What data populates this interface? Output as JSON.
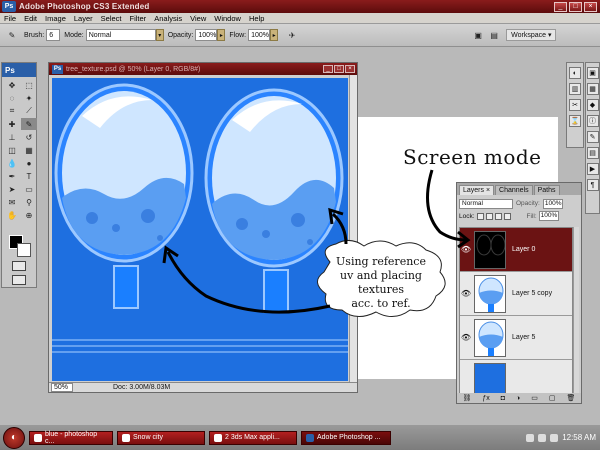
{
  "window": {
    "title": "Adobe Photoshop CS3 Extended",
    "app_badge": "Ps"
  },
  "menu": [
    "File",
    "Edit",
    "Image",
    "Layer",
    "Select",
    "Filter",
    "Analysis",
    "View",
    "Window",
    "Help"
  ],
  "options_bar": {
    "brush_label": "Brush:",
    "brush_size": "6",
    "mode_label": "Mode:",
    "mode_value": "Normal",
    "opacity_label": "Opacity:",
    "opacity_value": "100%",
    "flow_label": "Flow:",
    "flow_value": "100%",
    "workspace_label": "Workspace ▾"
  },
  "toolbox": {
    "header": "Ps"
  },
  "document": {
    "title": "tree_texture.psd @ 50% (Layer 0, RGB/8#)",
    "zoom": "50%",
    "doc_size": "Doc: 3.00M/8.03M"
  },
  "layers_panel": {
    "tabs": [
      "Layers ×",
      "Channels",
      "Paths"
    ],
    "blend_mode": "Normal",
    "opacity_label": "Opacity:",
    "opacity_value": "100%",
    "lock_label": "Lock:",
    "fill_label": "Fill:",
    "fill_value": "100%",
    "layers": [
      {
        "name": "Layer 0",
        "active": true
      },
      {
        "name": "Layer 5 copy",
        "active": false
      },
      {
        "name": "Layer 5",
        "active": false
      },
      {
        "name": "",
        "active": false
      }
    ]
  },
  "annotations": {
    "screen_mode": "Screen mode",
    "bubble_line1": "Using reference",
    "bubble_line2": "uv and placing textures",
    "bubble_line3": "acc. to ref."
  },
  "taskbar": {
    "tasks": [
      "blue - photoshop c...",
      "Snow city",
      "2 3ds Max appli...",
      "Adobe Photoshop ..."
    ],
    "clock": "12:58 AM"
  },
  "colors": {
    "accent": "#6b1313",
    "canvas_blue": "#1e6fe0",
    "foreground": "#000000",
    "background": "#ffffff"
  }
}
